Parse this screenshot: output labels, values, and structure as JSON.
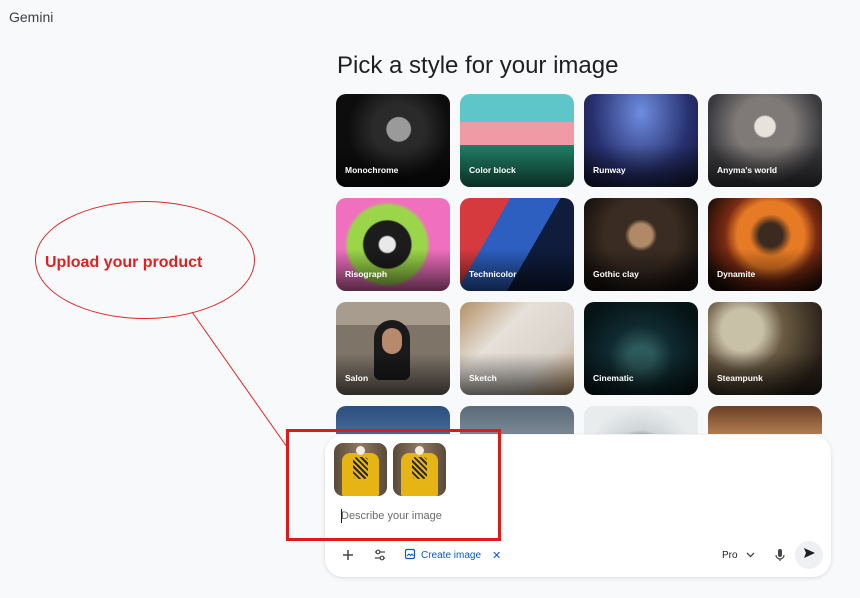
{
  "app": {
    "name": "Gemini"
  },
  "heading": "Pick a style for your image",
  "styles": [
    {
      "label": "Monochrome"
    },
    {
      "label": "Color block"
    },
    {
      "label": "Runway"
    },
    {
      "label": "Anyma's world"
    },
    {
      "label": "Risograph"
    },
    {
      "label": "Technicolor"
    },
    {
      "label": "Gothic clay"
    },
    {
      "label": "Dynamite"
    },
    {
      "label": "Salon"
    },
    {
      "label": "Sketch"
    },
    {
      "label": "Cinematic"
    },
    {
      "label": "Steampunk"
    },
    {
      "label": ""
    },
    {
      "label": ""
    },
    {
      "label": ""
    },
    {
      "label": ""
    }
  ],
  "annotation": {
    "text": "Upload your product",
    "color": "#e02020"
  },
  "composer": {
    "placeholder": "Describe your image",
    "create_image_label": "Create image",
    "model_label": "Pro",
    "icons": [
      "plus-icon",
      "tune-icon",
      "image-icon",
      "close-icon",
      "chevron-down-icon",
      "mic-icon",
      "send-icon"
    ]
  },
  "colors": {
    "accent": "#0b57d0",
    "annotation_red": "#e01a1a"
  }
}
